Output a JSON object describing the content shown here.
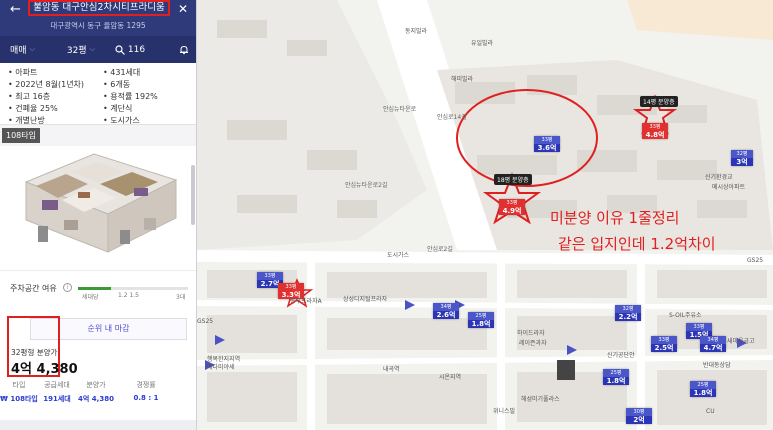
{
  "header": {
    "back": "←",
    "title": "불암동 대구안심2차시티프라디움",
    "address": "대구광역시 동구 율암동 1295",
    "close": "✕"
  },
  "filters": {
    "deal": "매매",
    "size": "32평",
    "search_count": "116"
  },
  "facts": [
    "아파트",
    "431세대",
    "2022년 8월(1년차)",
    "6개동",
    "최고 16층",
    "용적률 192%",
    "건폐율 25%",
    "계단식",
    "개별난방",
    "도시가스"
  ],
  "type_tab": "108타입",
  "parking": {
    "label": "주차공간 여유",
    "fill_pct": 30,
    "ticks": [
      "세대당",
      "1.2 1.5",
      "3대"
    ]
  },
  "sale": {
    "rank_text": "순위 내 마감",
    "price_label": "32평형 분양가",
    "price": "4억 4,380"
  },
  "table": {
    "headers": [
      "타입",
      "공급세대",
      "분양가",
      "경쟁률"
    ],
    "row": [
      "₩ 108타입",
      "191세대",
      "4억 4,380",
      "0.8 : 1"
    ]
  },
  "map": {
    "markers": [
      {
        "pct": "33평",
        "price": "3.6억",
        "red": false
      },
      {
        "pct": "33평",
        "price": "4.8억",
        "red": true
      },
      {
        "pct": "33평",
        "price": "4.9억",
        "red": true
      },
      {
        "pct": "32평",
        "price": "3억",
        "red": false
      },
      {
        "pct": "33평",
        "price": "2.7억",
        "red": false
      },
      {
        "pct": "33평",
        "price": "3.3억",
        "red": true
      },
      {
        "pct": "34평",
        "price": "2.6억",
        "red": false
      },
      {
        "pct": "25평",
        "price": "1.8억",
        "red": false
      },
      {
        "pct": "32평",
        "price": "2.2억",
        "red": false
      },
      {
        "pct": "33평",
        "price": "1.5억",
        "red": false
      },
      {
        "pct": "33평",
        "price": "2.5억",
        "red": false
      },
      {
        "pct": "34평",
        "price": "4.7억",
        "red": false
      },
      {
        "pct": "25평",
        "price": "1.8억",
        "red": false
      },
      {
        "pct": "25평",
        "price": "1.8억",
        "red": false
      },
      {
        "pct": "30평",
        "price": "2억",
        "red": false
      }
    ],
    "tags": [
      "14평 분양층",
      "18평 분양층"
    ],
    "annotations": [
      "미분양 이유 1줄정리",
      "같은 입지인데 1.2억차이"
    ],
    "pois": [
      "동지빌라",
      "유일빌라",
      "해피빌라",
      "안심뉴타운로",
      "신기환경교",
      "메시상아파트",
      "도시가스",
      "GS25",
      "상성디지털프라자",
      "동부프라자A",
      "행복한지지역",
      "매다미야세",
      "내곡역",
      "시온지역",
      "해성미기풀라스",
      "신기공단안",
      "하이드라자",
      "레이즌과자",
      "새마을금고",
      "반대동상담",
      "CU",
      "S-OIL주유소",
      "GS25",
      "위니스빌"
    ],
    "roads": [
      "안심뉴타운로2길",
      "안심로14길",
      "안심로2길"
    ]
  }
}
